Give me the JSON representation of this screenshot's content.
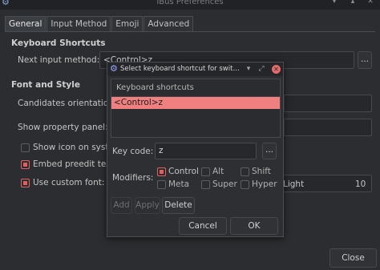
{
  "window": {
    "title": "IBus Preferences",
    "minimize_icon": "minimize-icon",
    "maximize_icon": "maximize-icon",
    "close_icon": "close-icon"
  },
  "tabs": [
    {
      "label": "General",
      "active": true
    },
    {
      "label": "Input Method",
      "active": false
    },
    {
      "label": "Emoji",
      "active": false
    },
    {
      "label": "Advanced",
      "active": false
    }
  ],
  "keyboard_shortcuts": {
    "section_title": "Keyboard Shortcuts",
    "next_input_method_label": "Next input method:",
    "next_input_method_value": "<Control>z",
    "more_button": "..."
  },
  "font_and_style": {
    "section_title": "Font and Style",
    "candidates_orientation_label": "Candidates orientation:",
    "show_property_panel_label": "Show property panel:",
    "show_icon_label": "Show icon on syste",
    "show_icon_checked": false,
    "embed_preedit_label": "Embed preedit text",
    "embed_preedit_checked": true,
    "use_custom_font_label": "Use custom font:",
    "use_custom_font_checked": true,
    "font_name": "Light",
    "font_size": "10"
  },
  "close_button": "Close",
  "dialog": {
    "title": "Select keyboard shortcut for swit…",
    "list_header": "Keyboard shortcuts",
    "shortcuts": [
      "<Control>z"
    ],
    "key_code_label": "Key code:",
    "key_code_value": "z",
    "key_code_more": "...",
    "modifiers_label": "Modifiers:",
    "modifiers": [
      {
        "label": "Control",
        "checked": true
      },
      {
        "label": "Alt",
        "checked": false
      },
      {
        "label": "Shift",
        "checked": false
      },
      {
        "label": "Meta",
        "checked": false
      },
      {
        "label": "Super",
        "checked": false
      },
      {
        "label": "Hyper",
        "checked": false
      }
    ],
    "add_button": "Add",
    "apply_button": "Apply",
    "delete_button": "Delete",
    "cancel_button": "Cancel",
    "ok_button": "OK"
  },
  "colors": {
    "accent": "#f08080",
    "close_red": "#e36b6b",
    "background": "#2b2d30"
  }
}
